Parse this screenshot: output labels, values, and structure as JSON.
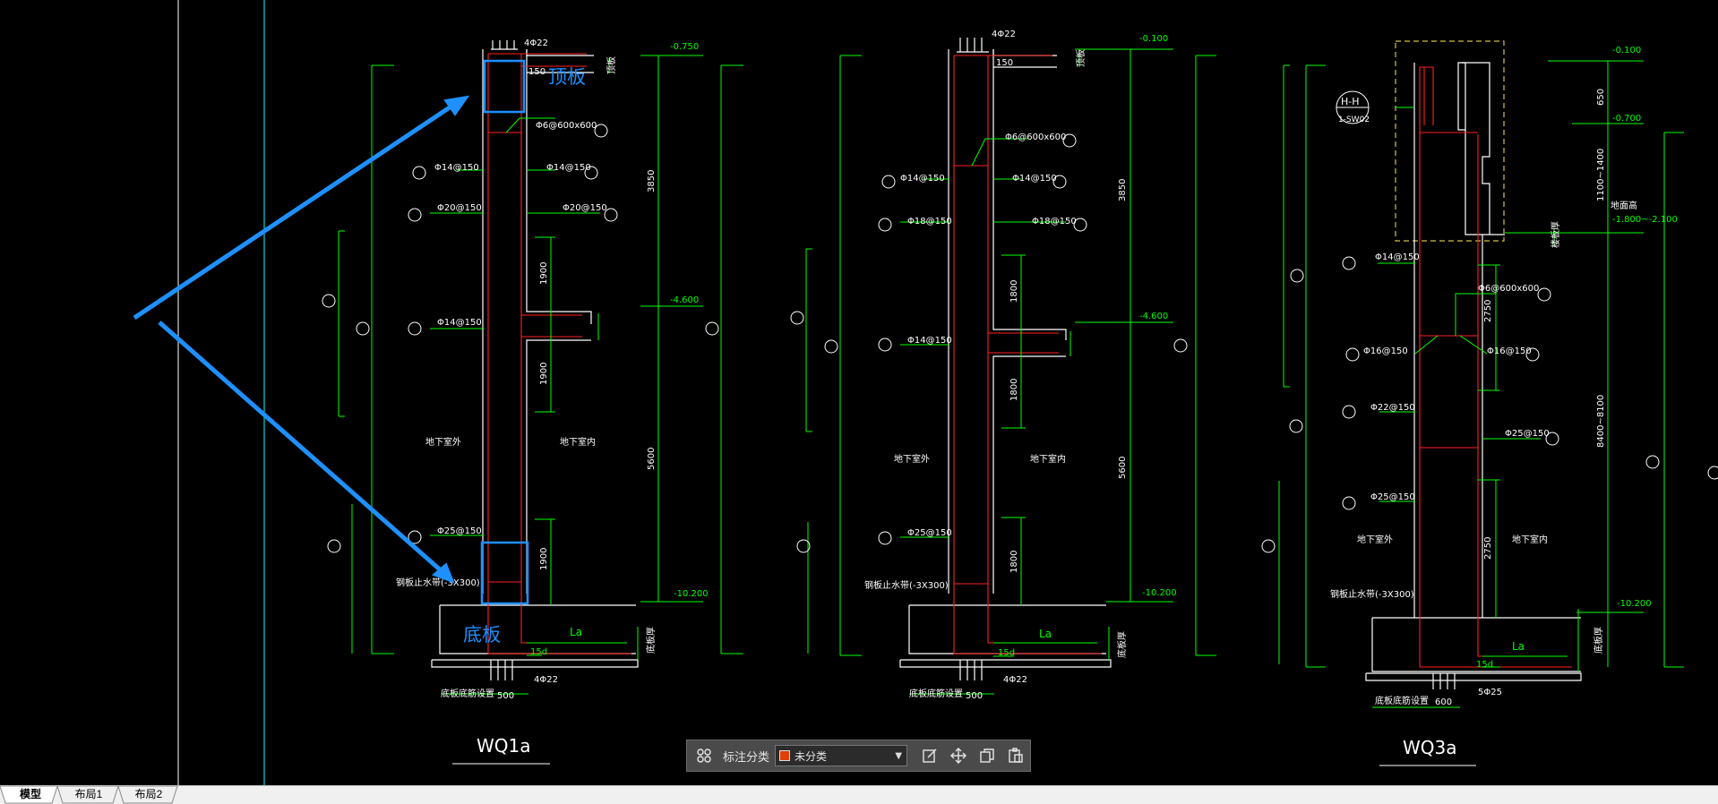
{
  "colors": {
    "background": "#000000",
    "wall_line": "#ffffff",
    "rebar": "#ff2020",
    "dimension": "#00ff00",
    "annotation_arrow": "#1e90ff",
    "border_line": "#00ffff",
    "title_line": "#ffffff"
  },
  "drawings": [
    {
      "title": "WQ1a",
      "elev": [
        "-0.750",
        "-4.600",
        "-10.200"
      ],
      "rebar": [
        "4Φ22",
        "Φ6@600x600",
        "Φ14@150",
        "Φ14@150",
        "Φ20@150",
        "Φ20@150",
        "Φ14@150",
        "Φ25@150"
      ],
      "dims": [
        "3850",
        "5600",
        "1900",
        "1900",
        "1900",
        "150",
        "500",
        "La",
        "15d"
      ],
      "rooms": [
        "地下室外",
        "地下室内"
      ],
      "waterstop": "钢板止水带(-3X300)",
      "bottom": [
        "4Φ22",
        "底板底筋设置"
      ],
      "side": [
        "顶板",
        "底板厚"
      ]
    },
    {
      "title": "",
      "elev": [
        "-0.100",
        "-4.600",
        "-10.200"
      ],
      "rebar": [
        "4Φ22",
        "Φ6@600x600",
        "Φ14@150",
        "Φ14@150",
        "Φ18@150",
        "Φ18@150",
        "Φ14@150",
        "Φ25@150"
      ],
      "dims": [
        "3850",
        "5600",
        "1800",
        "1800",
        "1800",
        "150",
        "500",
        "La",
        "15d"
      ],
      "rooms": [
        "地下室外",
        "地下室内"
      ],
      "waterstop": "钢板止水带(-3X300)",
      "bottom": [
        "4Φ22",
        "底板底筋设置"
      ],
      "side": [
        "顶板",
        "底板厚"
      ]
    },
    {
      "title": "WQ3a",
      "elev": [
        "-0.100",
        "-0.700",
        "-1.800~-2.100",
        "-10.200"
      ],
      "rebar": [
        "Φ14@150",
        "Φ6@600x600",
        "Φ16@150",
        "Φ16@150",
        "Φ22@150",
        "Φ25@150",
        "Φ25@150"
      ],
      "dims": [
        "650",
        "1100~1400",
        "2750",
        "2750",
        "8400~8100",
        "La",
        "15d",
        "600"
      ],
      "rooms": [
        "地下室外",
        "地下室内"
      ],
      "waterstop": "钢板止水带(-3X300)",
      "bottom": [
        "5Φ25",
        "底板底筋设置"
      ],
      "section": [
        "H-H",
        "1-SW02"
      ],
      "side": [
        "楼板厚",
        "底板厚",
        "地面高"
      ]
    }
  ],
  "callouts": {
    "top": "顶板",
    "bottom": "底板"
  },
  "toolbar": {
    "label": "标注分类",
    "category": "未分类",
    "category_color": "#e0400a"
  },
  "tabs": [
    "模型",
    "布局1",
    "布局2"
  ]
}
